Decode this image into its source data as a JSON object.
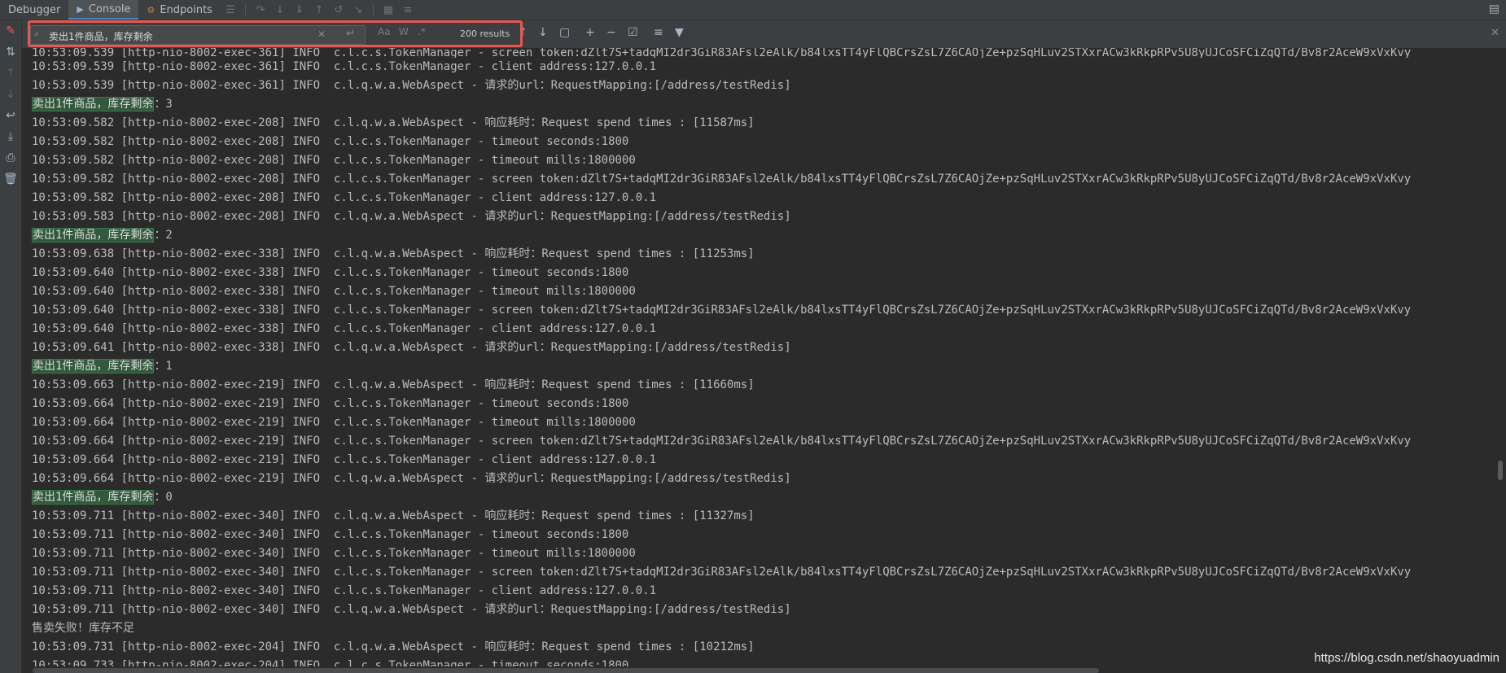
{
  "tabs": [
    {
      "label": "Debugger",
      "active": false
    },
    {
      "label": "Console",
      "active": true
    },
    {
      "label": "Endpoints",
      "active": false
    }
  ],
  "search": {
    "query": "卖出1件商品，库存剩余",
    "results": "200 results",
    "match_case": "Aa",
    "words": "W",
    "regex": ".*"
  },
  "log_lines": [
    {
      "time": "10:53:09.539",
      "thread": "[http-nio-8002-exec-361]",
      "level": "INFO",
      "logger": "c.l.c.s.TokenManager",
      "msg": "- screen token:dZlt7S+tadqMI2dr3GiR83AFsl2eAlk/b84lxsTT4yFlQBCrsZsL7Z6CAOjZe+pzSqHLuv2STXxrACw3kRkpRPv5U8yUJCoSFCiZqQTd/Bv8r2AceW9xVxKvy",
      "partial": true
    },
    {
      "time": "10:53:09.539",
      "thread": "[http-nio-8002-exec-361]",
      "level": "INFO",
      "logger": "c.l.c.s.TokenManager",
      "msg": "- client address:127.0.0.1"
    },
    {
      "time": "10:53:09.539",
      "thread": "[http-nio-8002-exec-361]",
      "level": "INFO",
      "logger": "c.l.q.w.a.WebAspect",
      "msg": "- 请求的url：RequestMapping:[/address/testRedis]"
    },
    {
      "match": "卖出1件商品，库存剩余",
      "rest": "：3"
    },
    {
      "time": "10:53:09.582",
      "thread": "[http-nio-8002-exec-208]",
      "level": "INFO",
      "logger": "c.l.q.w.a.WebAspect",
      "msg": "- 响应耗时：Request spend times : [11587ms]"
    },
    {
      "time": "10:53:09.582",
      "thread": "[http-nio-8002-exec-208]",
      "level": "INFO",
      "logger": "c.l.c.s.TokenManager",
      "msg": "- timeout seconds:1800"
    },
    {
      "time": "10:53:09.582",
      "thread": "[http-nio-8002-exec-208]",
      "level": "INFO",
      "logger": "c.l.c.s.TokenManager",
      "msg": "- timeout mills:1800000"
    },
    {
      "time": "10:53:09.582",
      "thread": "[http-nio-8002-exec-208]",
      "level": "INFO",
      "logger": "c.l.c.s.TokenManager",
      "msg": "- screen token:dZlt7S+tadqMI2dr3GiR83AFsl2eAlk/b84lxsTT4yFlQBCrsZsL7Z6CAOjZe+pzSqHLuv2STXxrACw3kRkpRPv5U8yUJCoSFCiZqQTd/Bv8r2AceW9xVxKvy"
    },
    {
      "time": "10:53:09.582",
      "thread": "[http-nio-8002-exec-208]",
      "level": "INFO",
      "logger": "c.l.c.s.TokenManager",
      "msg": "- client address:127.0.0.1"
    },
    {
      "time": "10:53:09.583",
      "thread": "[http-nio-8002-exec-208]",
      "level": "INFO",
      "logger": "c.l.q.w.a.WebAspect",
      "msg": "- 请求的url：RequestMapping:[/address/testRedis]"
    },
    {
      "match": "卖出1件商品，库存剩余",
      "rest": "：2"
    },
    {
      "time": "10:53:09.638",
      "thread": "[http-nio-8002-exec-338]",
      "level": "INFO",
      "logger": "c.l.q.w.a.WebAspect",
      "msg": "- 响应耗时：Request spend times : [11253ms]"
    },
    {
      "time": "10:53:09.640",
      "thread": "[http-nio-8002-exec-338]",
      "level": "INFO",
      "logger": "c.l.c.s.TokenManager",
      "msg": "- timeout seconds:1800"
    },
    {
      "time": "10:53:09.640",
      "thread": "[http-nio-8002-exec-338]",
      "level": "INFO",
      "logger": "c.l.c.s.TokenManager",
      "msg": "- timeout mills:1800000"
    },
    {
      "time": "10:53:09.640",
      "thread": "[http-nio-8002-exec-338]",
      "level": "INFO",
      "logger": "c.l.c.s.TokenManager",
      "msg": "- screen token:dZlt7S+tadqMI2dr3GiR83AFsl2eAlk/b84lxsTT4yFlQBCrsZsL7Z6CAOjZe+pzSqHLuv2STXxrACw3kRkpRPv5U8yUJCoSFCiZqQTd/Bv8r2AceW9xVxKvy"
    },
    {
      "time": "10:53:09.640",
      "thread": "[http-nio-8002-exec-338]",
      "level": "INFO",
      "logger": "c.l.c.s.TokenManager",
      "msg": "- client address:127.0.0.1"
    },
    {
      "time": "10:53:09.641",
      "thread": "[http-nio-8002-exec-338]",
      "level": "INFO",
      "logger": "c.l.q.w.a.WebAspect",
      "msg": "- 请求的url：RequestMapping:[/address/testRedis]"
    },
    {
      "match": "卖出1件商品，库存剩余",
      "rest": "：1"
    },
    {
      "time": "10:53:09.663",
      "thread": "[http-nio-8002-exec-219]",
      "level": "INFO",
      "logger": "c.l.q.w.a.WebAspect",
      "msg": "- 响应耗时：Request spend times : [11660ms]"
    },
    {
      "time": "10:53:09.664",
      "thread": "[http-nio-8002-exec-219]",
      "level": "INFO",
      "logger": "c.l.c.s.TokenManager",
      "msg": "- timeout seconds:1800"
    },
    {
      "time": "10:53:09.664",
      "thread": "[http-nio-8002-exec-219]",
      "level": "INFO",
      "logger": "c.l.c.s.TokenManager",
      "msg": "- timeout mills:1800000"
    },
    {
      "time": "10:53:09.664",
      "thread": "[http-nio-8002-exec-219]",
      "level": "INFO",
      "logger": "c.l.c.s.TokenManager",
      "msg": "- screen token:dZlt7S+tadqMI2dr3GiR83AFsl2eAlk/b84lxsTT4yFlQBCrsZsL7Z6CAOjZe+pzSqHLuv2STXxrACw3kRkpRPv5U8yUJCoSFCiZqQTd/Bv8r2AceW9xVxKvy"
    },
    {
      "time": "10:53:09.664",
      "thread": "[http-nio-8002-exec-219]",
      "level": "INFO",
      "logger": "c.l.c.s.TokenManager",
      "msg": "- client address:127.0.0.1"
    },
    {
      "time": "10:53:09.664",
      "thread": "[http-nio-8002-exec-219]",
      "level": "INFO",
      "logger": "c.l.q.w.a.WebAspect",
      "msg": "- 请求的url：RequestMapping:[/address/testRedis]"
    },
    {
      "match": "卖出1件商品，库存剩余",
      "rest": "：0"
    },
    {
      "time": "10:53:09.711",
      "thread": "[http-nio-8002-exec-340]",
      "level": "INFO",
      "logger": "c.l.q.w.a.WebAspect",
      "msg": "- 响应耗时：Request spend times : [11327ms]"
    },
    {
      "time": "10:53:09.711",
      "thread": "[http-nio-8002-exec-340]",
      "level": "INFO",
      "logger": "c.l.c.s.TokenManager",
      "msg": "- timeout seconds:1800"
    },
    {
      "time": "10:53:09.711",
      "thread": "[http-nio-8002-exec-340]",
      "level": "INFO",
      "logger": "c.l.c.s.TokenManager",
      "msg": "- timeout mills:1800000"
    },
    {
      "time": "10:53:09.711",
      "thread": "[http-nio-8002-exec-340]",
      "level": "INFO",
      "logger": "c.l.c.s.TokenManager",
      "msg": "- screen token:dZlt7S+tadqMI2dr3GiR83AFsl2eAlk/b84lxsTT4yFlQBCrsZsL7Z6CAOjZe+pzSqHLuv2STXxrACw3kRkpRPv5U8yUJCoSFCiZqQTd/Bv8r2AceW9xVxKvy"
    },
    {
      "time": "10:53:09.711",
      "thread": "[http-nio-8002-exec-340]",
      "level": "INFO",
      "logger": "c.l.c.s.TokenManager",
      "msg": "- client address:127.0.0.1"
    },
    {
      "time": "10:53:09.711",
      "thread": "[http-nio-8002-exec-340]",
      "level": "INFO",
      "logger": "c.l.q.w.a.WebAspect",
      "msg": "- 请求的url：RequestMapping:[/address/testRedis]"
    },
    {
      "plain": "售卖失败！库存不足"
    },
    {
      "time": "10:53:09.731",
      "thread": "[http-nio-8002-exec-204]",
      "level": "INFO",
      "logger": "c.l.q.w.a.WebAspect",
      "msg": "- 响应耗时：Request spend times : [10212ms]"
    },
    {
      "time": "10:53:09.733",
      "thread": "[http-nio-8002-exec-204]",
      "level": "INFO",
      "logger": "c.l.c.s.TokenManager",
      "msg": "- timeout seconds:1800"
    }
  ],
  "watermark": "https://blog.csdn.net/shaoyuadmin",
  "colors": {
    "background": "#2b2b2b",
    "match_highlight": "#32593d",
    "search_outline": "#e8564f"
  }
}
